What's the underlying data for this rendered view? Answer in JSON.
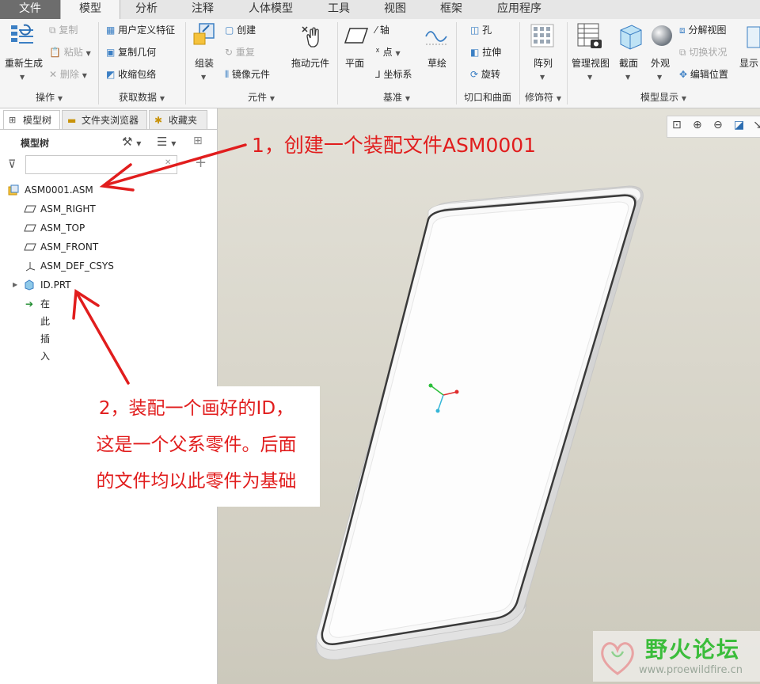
{
  "tabs": [
    {
      "label": "文件",
      "state": "file"
    },
    {
      "label": "模型",
      "state": "active"
    },
    {
      "label": "分析"
    },
    {
      "label": "注释"
    },
    {
      "label": "人体模型"
    },
    {
      "label": "工具"
    },
    {
      "label": "视图"
    },
    {
      "label": "框架"
    },
    {
      "label": "应用程序"
    }
  ],
  "ribbon": {
    "operations": {
      "regenerate": "重新生成",
      "copy": "复制",
      "paste": "粘贴",
      "delete": "删除",
      "group": "操作"
    },
    "get_data": {
      "udf": "用户定义特征",
      "copy_geometry": "复制几何",
      "shrinkwrap": "收缩包络",
      "group": "获取数据"
    },
    "component": {
      "assemble": "组装",
      "create": "创建",
      "repeat": "重复",
      "mirror": "镜像元件",
      "drag": "拖动元件",
      "group": "元件"
    },
    "datum": {
      "plane": "平面",
      "axis": "轴",
      "point": "点",
      "csys": "坐标系",
      "sketch": "草绘",
      "group": "基准"
    },
    "cut_surface": {
      "hole": "孔",
      "extrude": "拉伸",
      "revolve": "旋转",
      "group": "切口和曲面"
    },
    "modifiers": {
      "pattern": "阵列",
      "group": "修饰符"
    },
    "model_display": {
      "manage_views": "管理视图",
      "section": "截面",
      "appearance": "外观",
      "explode": "分解视图",
      "toggle_state": "切换状况",
      "edit_position": "编辑位置",
      "display": "显示",
      "group": "模型显示"
    }
  },
  "panel": {
    "tabs": [
      "模型树",
      "文件夹浏览器",
      "收藏夹"
    ],
    "header": "模型树",
    "filter_placeholder": "",
    "tree": [
      {
        "label": "ASM0001.ASM",
        "icon": "assembly-icon"
      },
      {
        "label": "ASM_RIGHT",
        "icon": "datum-plane-icon"
      },
      {
        "label": "ASM_TOP",
        "icon": "datum-plane-icon"
      },
      {
        "label": "ASM_FRONT",
        "icon": "datum-plane-icon"
      },
      {
        "label": "ASM_DEF_CSYS",
        "icon": "csys-icon"
      },
      {
        "label": "ID.PRT",
        "icon": "part-icon"
      },
      {
        "label": "在此插入",
        "icon": "insert-arrow-icon"
      }
    ]
  },
  "annotations": {
    "note1": "1，创建一个装配文件ASM0001",
    "note2": [
      "2，装配一个画好的ID，",
      "这是一个父系零件。后面",
      "的文件均以此零件为基础"
    ]
  },
  "watermark": {
    "title": "野火论坛",
    "url": "www.proewildfire.cn"
  },
  "colors": {
    "annotation": "#e11d1d",
    "watermark": "#3bbd3b"
  }
}
